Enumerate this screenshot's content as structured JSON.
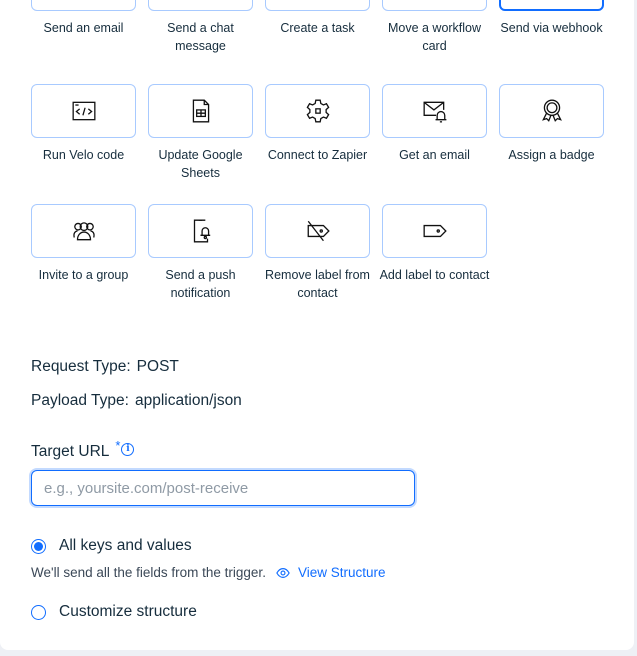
{
  "actions": [
    {
      "label": "Send an email",
      "icon": "email-icon"
    },
    {
      "label": "Send a chat message",
      "icon": "chat-icon"
    },
    {
      "label": "Create a task",
      "icon": "task-icon"
    },
    {
      "label": "Move a workflow card",
      "icon": "workflow-card-icon"
    },
    {
      "label": "Send via webhook",
      "icon": "webhook-icon",
      "selected": true
    },
    {
      "label": "Run Velo code",
      "icon": "code-icon"
    },
    {
      "label": "Update Google Sheets",
      "icon": "spreadsheet-icon"
    },
    {
      "label": "Connect to Zapier",
      "icon": "gear-icon"
    },
    {
      "label": "Get an email",
      "icon": "email-bell-icon"
    },
    {
      "label": "Assign a badge",
      "icon": "badge-icon"
    },
    {
      "label": "Invite to a group",
      "icon": "group-icon"
    },
    {
      "label": "Send a push notification",
      "icon": "push-notification-icon"
    },
    {
      "label": "Remove label from contact",
      "icon": "remove-label-icon"
    },
    {
      "label": "Add label to contact",
      "icon": "label-icon"
    }
  ],
  "webhook": {
    "request_type_label": "Request Type:",
    "request_type_value": "POST",
    "payload_type_label": "Payload Type:",
    "payload_type_value": "application/json",
    "target_url_label": "Target URL",
    "required_marker": "*",
    "info_glyph": "i",
    "target_url_value": "",
    "target_url_placeholder": "e.g., yoursite.com/post-receive"
  },
  "structure": {
    "options": [
      {
        "label": "All keys and values",
        "checked": true
      },
      {
        "label": "Customize structure",
        "checked": false
      }
    ],
    "hint": "We'll send all the fields from the trigger.",
    "view_link": "View Structure"
  },
  "colors": {
    "accent": "#116dff",
    "tile_border": "#a8caff",
    "text": "#162d3d"
  }
}
